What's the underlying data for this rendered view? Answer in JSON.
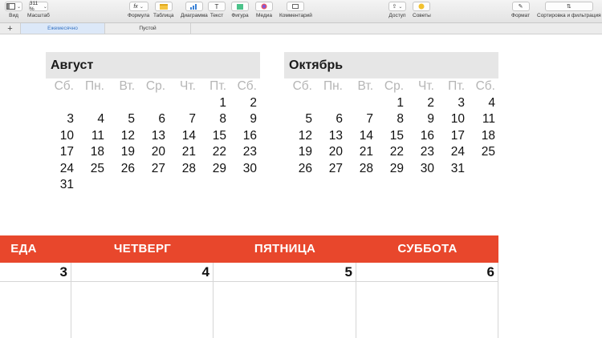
{
  "toolbar": {
    "view_label": "Вид",
    "zoom_value": "311 %",
    "zoom_label": "Масштаб",
    "formula_label": "Формула",
    "table_label": "Таблица",
    "chart_label": "Диаграмма",
    "text_label": "Текст",
    "shape_label": "Фигура",
    "media_label": "Медиа",
    "comment_label": "Комментарий",
    "share_label": "Доступ",
    "tips_label": "Советы",
    "format_label": "Формат",
    "sort_label": "Сортировка и фильтрация"
  },
  "tabs": {
    "add": "+",
    "items": [
      {
        "label": "Ежемесячно",
        "active": true
      },
      {
        "label": "Пустой",
        "active": false
      }
    ]
  },
  "weekdays": [
    "Сб.",
    "Пн.",
    "Вт.",
    "Ср.",
    "Чт.",
    "Пт.",
    "Сб."
  ],
  "august": {
    "title": "Август",
    "rows": [
      [
        "",
        "",
        "",
        "",
        "",
        "1",
        "2"
      ],
      [
        "3",
        "4",
        "5",
        "6",
        "7",
        "8",
        "9"
      ],
      [
        "10",
        "11",
        "12",
        "13",
        "14",
        "15",
        "16"
      ],
      [
        "17",
        "18",
        "19",
        "20",
        "21",
        "22",
        "23"
      ],
      [
        "24",
        "25",
        "26",
        "27",
        "28",
        "29",
        "30"
      ],
      [
        "31",
        "",
        "",
        "",
        "",
        "",
        ""
      ]
    ]
  },
  "october": {
    "title": "Октябрь",
    "rows": [
      [
        "",
        "",
        "",
        "1",
        "2",
        "3",
        "4"
      ],
      [
        "5",
        "6",
        "7",
        "8",
        "9",
        "10",
        "11"
      ],
      [
        "12",
        "13",
        "14",
        "15",
        "16",
        "17",
        "18"
      ],
      [
        "19",
        "20",
        "21",
        "22",
        "23",
        "24",
        "25"
      ],
      [
        "26",
        "27",
        "28",
        "29",
        "30",
        "31",
        ""
      ]
    ]
  },
  "week": {
    "days": [
      "ЕДА",
      "ЧЕТВЕРГ",
      "ПЯТНИЦА",
      "СУББОТА"
    ],
    "dates": [
      "3",
      "4",
      "5",
      "6"
    ]
  },
  "colors": {
    "accent": "#e8472c",
    "tab_active": "#3a76c4"
  }
}
